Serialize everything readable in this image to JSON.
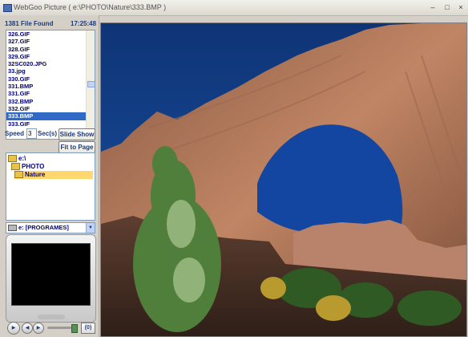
{
  "window": {
    "title": "WebGoo Picture  ( e:\\PHOTO\\Nature\\333.BMP )",
    "controls": {
      "minimize": "–",
      "maximize": "□",
      "close": "×"
    }
  },
  "status": {
    "found": "1381 File Found",
    "time": "17:25:48"
  },
  "file_list": {
    "items": [
      "326.GIF",
      "327.GIF",
      "328.GIF",
      "329.GIF",
      "32SC020.JPG",
      "33.jpg",
      "330.GIF",
      "331.BMP",
      "331.GIF",
      "332.BMP",
      "332.GIF",
      "333.BMP",
      "333.GIF"
    ],
    "selected": "333.BMP"
  },
  "speed": {
    "label": "Speed",
    "value": "3",
    "unit": "Sec(s)"
  },
  "buttons": {
    "slideshow": "Slide Show",
    "fit": "Fit to Page",
    "zero": "(0)"
  },
  "tree": {
    "nodes": [
      "e:\\",
      "PHOTO",
      "Nature"
    ],
    "selected": "Nature"
  },
  "drive": {
    "value": "e: [PROGRAMES]"
  },
  "colors": {
    "sky": "#123f86",
    "rock": "#b37658",
    "selection": "#316ac5",
    "tree_selection": "#ffd76e"
  },
  "icons": [
    "app-icon",
    "folder-icon",
    "drive-icon",
    "play-icon",
    "prev-icon",
    "next-icon",
    "chevron-down-icon"
  ]
}
